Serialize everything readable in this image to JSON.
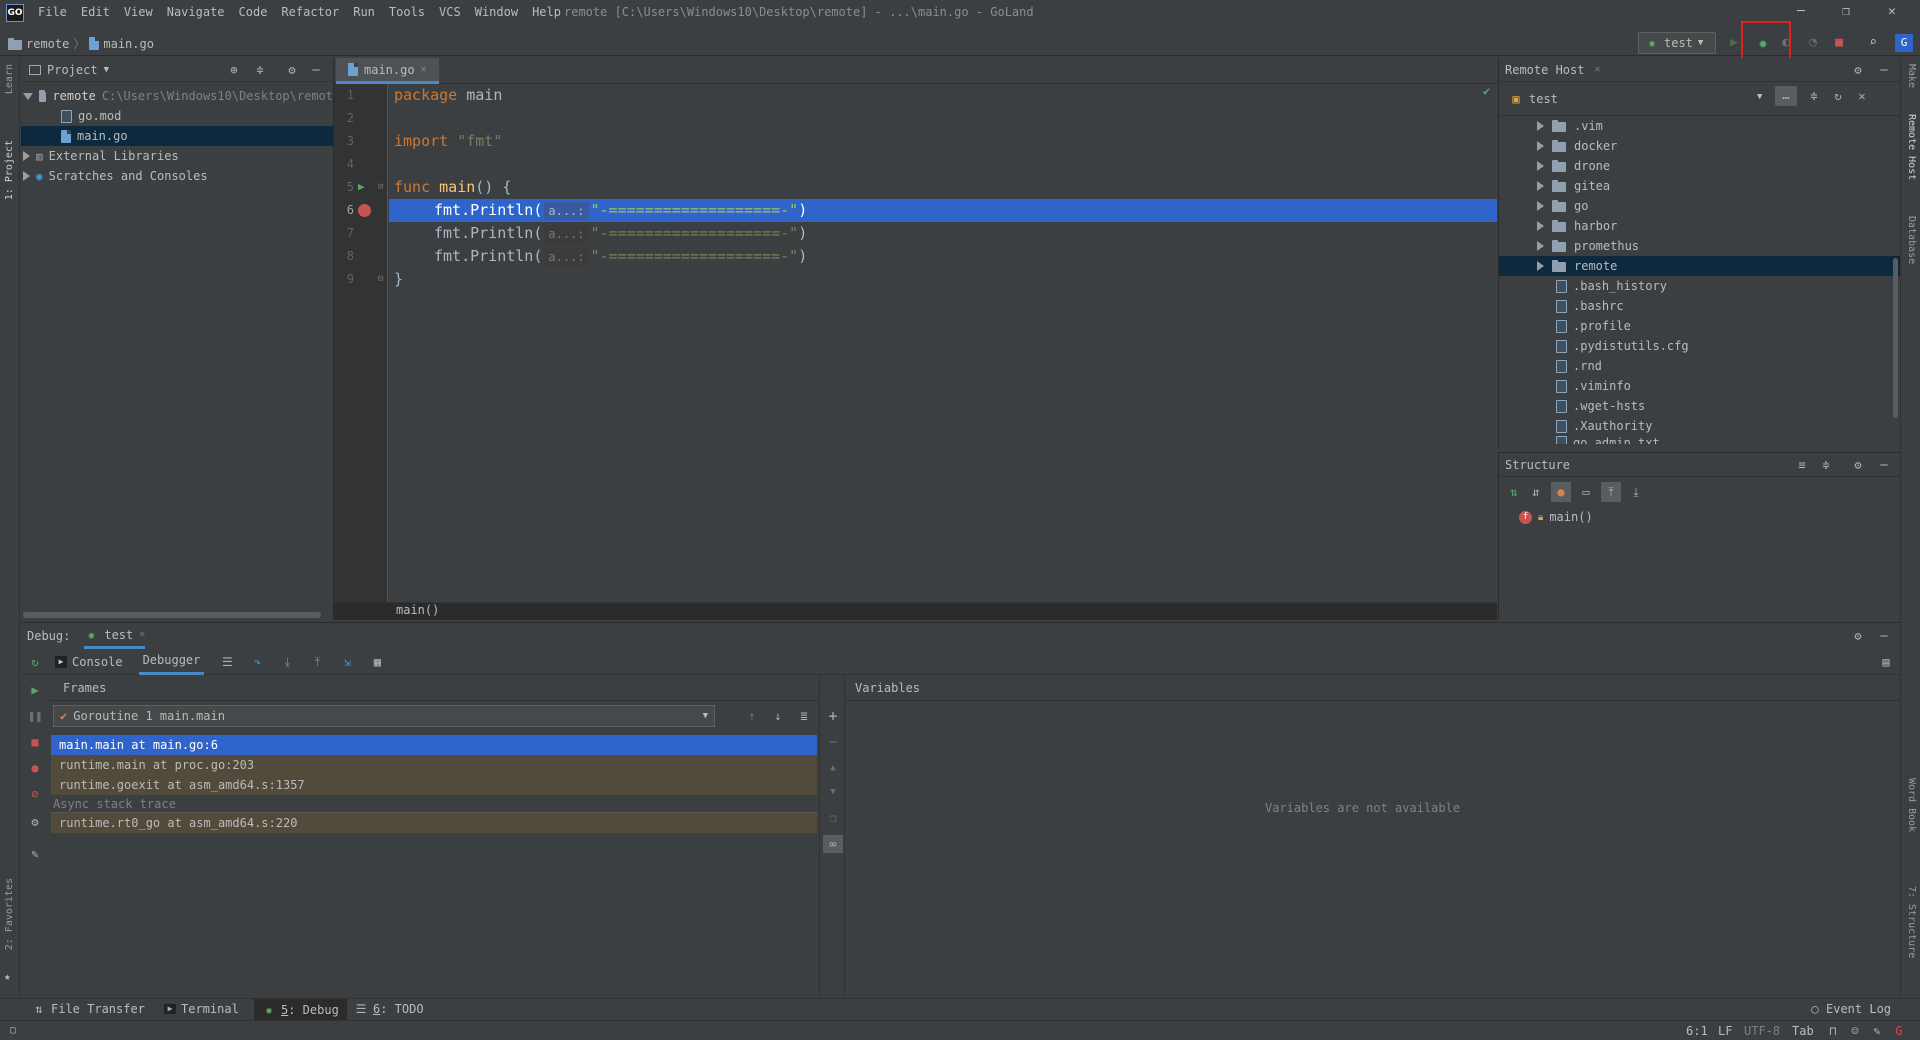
{
  "window": {
    "logo": "GO",
    "title": "remote [C:\\Users\\Windows10\\Desktop\\remote] - ...\\main.go - GoLand",
    "menu": [
      "File",
      "Edit",
      "View",
      "Navigate",
      "Code",
      "Refactor",
      "Run",
      "Tools",
      "VCS",
      "Window",
      "Help"
    ]
  },
  "navbar": {
    "breadcrumb": [
      "remote",
      "main.go"
    ],
    "run_config": "test"
  },
  "left_stripe": {
    "learn": "Learn",
    "project": "1: Project",
    "favorites": "2: Favorites"
  },
  "right_stripe": {
    "make": "Make",
    "remote_host": "Remote Host",
    "database": "Database",
    "word_book": "Word Book",
    "structure": "7: Structure"
  },
  "project": {
    "header": "Project",
    "tree": [
      {
        "label": "remote",
        "path": "C:\\Users\\Windows10\\Desktop\\remot"
      },
      {
        "label": "go.mod"
      },
      {
        "label": "main.go"
      },
      {
        "label": "External Libraries"
      },
      {
        "label": "Scratches and Consoles"
      }
    ]
  },
  "editor": {
    "tab": "main.go",
    "line_numbers": [
      "1",
      "2",
      "3",
      "4",
      "5",
      "6",
      "7",
      "8",
      "9"
    ],
    "lines": {
      "l1_kw": "package",
      "l1_rest": " main",
      "l3_kw": "import",
      "l3_str": " \"fmt\"",
      "l5_kw": "func",
      "l5_fn": " main",
      "l5_rest": "() {",
      "println": "fmt.Println(",
      "hint": "a...:",
      "arg": "\"-===================-\"",
      "close": ")",
      "l9": "}"
    },
    "breadcrumb": "main()"
  },
  "remote_host": {
    "title": "Remote Host",
    "server": "test",
    "folders": [
      ".vim",
      "docker",
      "drone",
      "gitea",
      "go",
      "harbor",
      "promethus",
      "remote"
    ],
    "files": [
      ".bash_history",
      ".bashrc",
      ".profile",
      ".pydistutils.cfg",
      ".rnd",
      ".viminfo",
      ".wget-hsts",
      ".Xauthority",
      "go_admin.txt"
    ]
  },
  "structure": {
    "title": "Structure",
    "item": "main()"
  },
  "debug": {
    "label": "Debug:",
    "session": "test",
    "tab_console": "Console",
    "tab_debugger": "Debugger",
    "frames_title": "Frames",
    "goroutine": "Goroutine 1 main.main",
    "frames": [
      "main.main at main.go:6",
      "runtime.main at proc.go:203",
      "runtime.goexit at asm_amd64.s:1357"
    ],
    "async_label": "Async stack trace",
    "async_frames": [
      "runtime.rt0_go at asm_amd64.s:220"
    ],
    "variables_title": "Variables",
    "variables_empty": "Variables are not available"
  },
  "bottom_tabs": {
    "file_transfer": "File Transfer",
    "terminal": "Terminal",
    "debug_num": "5",
    "debug": ": Debug",
    "todo_num": "6",
    "todo": ": TODO",
    "event_log": "Event Log"
  },
  "status": {
    "position": "6:1",
    "line_sep": "LF",
    "encoding": "UTF-8",
    "indent": "Tab"
  },
  "colors": {
    "accent": "#2f65ca",
    "highlight_box": "#e0201f",
    "debug_green": "#59a869",
    "stop_red": "#c75450"
  }
}
